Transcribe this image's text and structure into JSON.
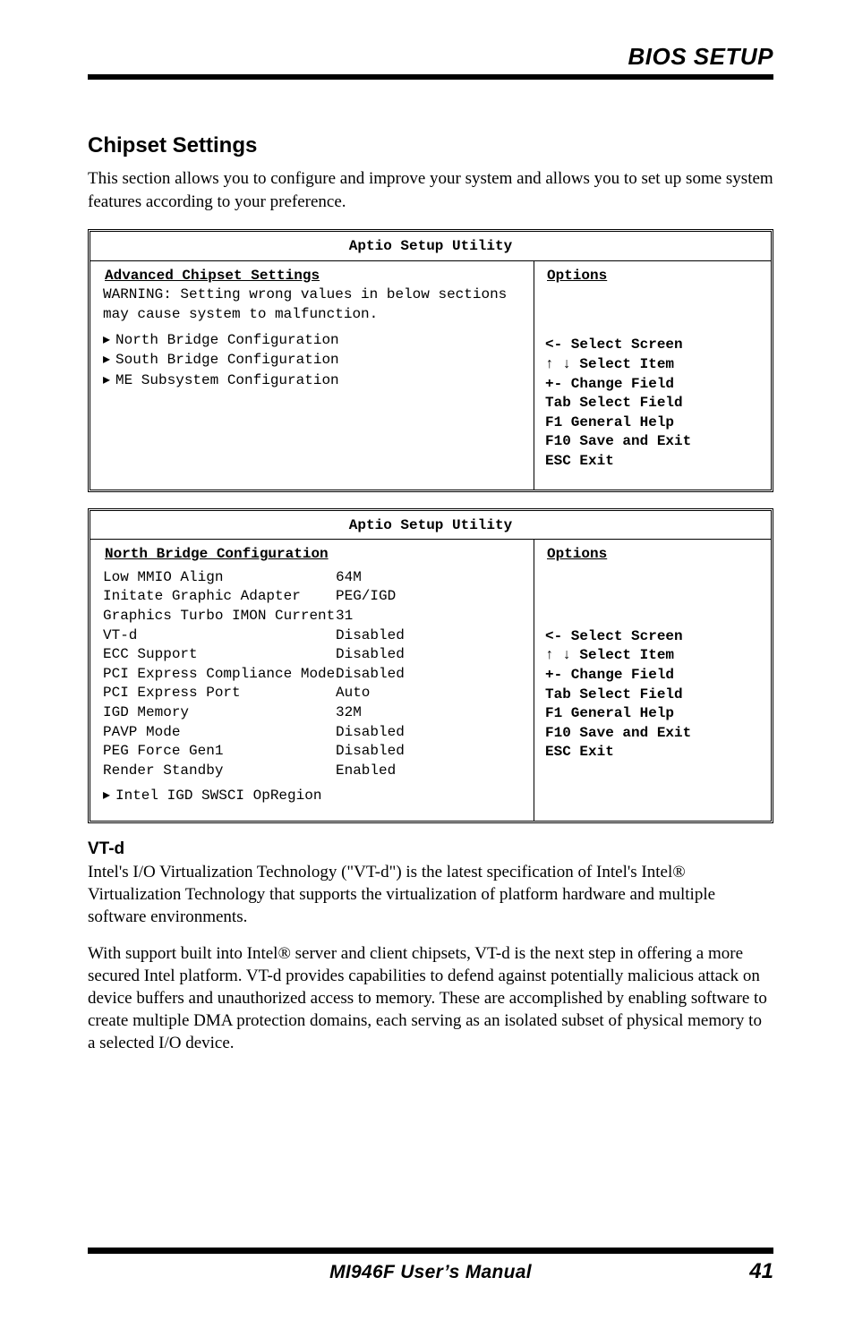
{
  "header": {
    "title": "BIOS SETUP"
  },
  "section": {
    "heading": "Chipset Settings",
    "desc": "This section allows you to configure and improve your system and allows you to set up some system features according to your preference."
  },
  "box1": {
    "title": "Aptio Setup Utility",
    "left_section_title": "Advanced Chipset Settings",
    "warn1": "WARNING: Setting wrong values in below sections",
    "warn2": "         may cause system to malfunction.",
    "items": [
      "North Bridge Configuration",
      "South Bridge Configuration",
      "ME Subsystem Configuration"
    ],
    "right_title": "Options",
    "help": [
      "<-  Select Screen",
      "↑ ↓ Select Item",
      "+-  Change Field",
      "Tab Select Field",
      "F1  General Help",
      "F10 Save and Exit",
      "ESC Exit"
    ]
  },
  "box2": {
    "title": "Aptio Setup Utility",
    "left_section_title": "North Bridge Configuration",
    "rows": [
      {
        "k": "Low MMIO Align",
        "v": "64M"
      },
      {
        "k": "Initate Graphic Adapter",
        "v": "PEG/IGD"
      },
      {
        "k": "Graphics Turbo IMON Current",
        "v": "31"
      },
      {
        "k": "VT-d",
        "v": "Disabled"
      },
      {
        "k": "ECC Support",
        "v": "Disabled"
      },
      {
        "k": "PCI Express Compliance Mode",
        "v": "Disabled"
      },
      {
        "k": "PCI Express Port",
        "v": "Auto"
      },
      {
        "k": "IGD Memory",
        "v": "32M"
      },
      {
        "k": "PAVP Mode",
        "v": "Disabled"
      },
      {
        "k": "PEG Force Gen1",
        "v": "Disabled"
      },
      {
        "k": "Render Standby",
        "v": "Enabled"
      }
    ],
    "submenu": "Intel IGD SWSCI OpRegion",
    "right_title": "Options",
    "help": [
      "<-  Select Screen",
      "↑ ↓ Select Item",
      "+-  Change Field",
      "Tab Select Field",
      "F1  General Help",
      "F10 Save and Exit",
      "ESC Exit"
    ]
  },
  "notes": {
    "heading": "VT-d",
    "p1": "Intel's I/O Virtualization Technology (\"VT-d\") is the latest specification of Intel's Intel® Virtualization Technology that supports the virtualization of platform hardware and multiple software environments.",
    "p2": "With support built into Intel® server and client chipsets, VT-d is the next step in offering a more secured Intel platform. VT-d provides capabilities to defend against potentially malicious attack on device buffers and unauthorized access to memory. These are accomplished by enabling software to create multiple DMA protection domains, each serving as an isolated subset of physical memory to a selected I/O device."
  },
  "footer": {
    "center": "MI946F User’s Manual",
    "page": "41"
  }
}
